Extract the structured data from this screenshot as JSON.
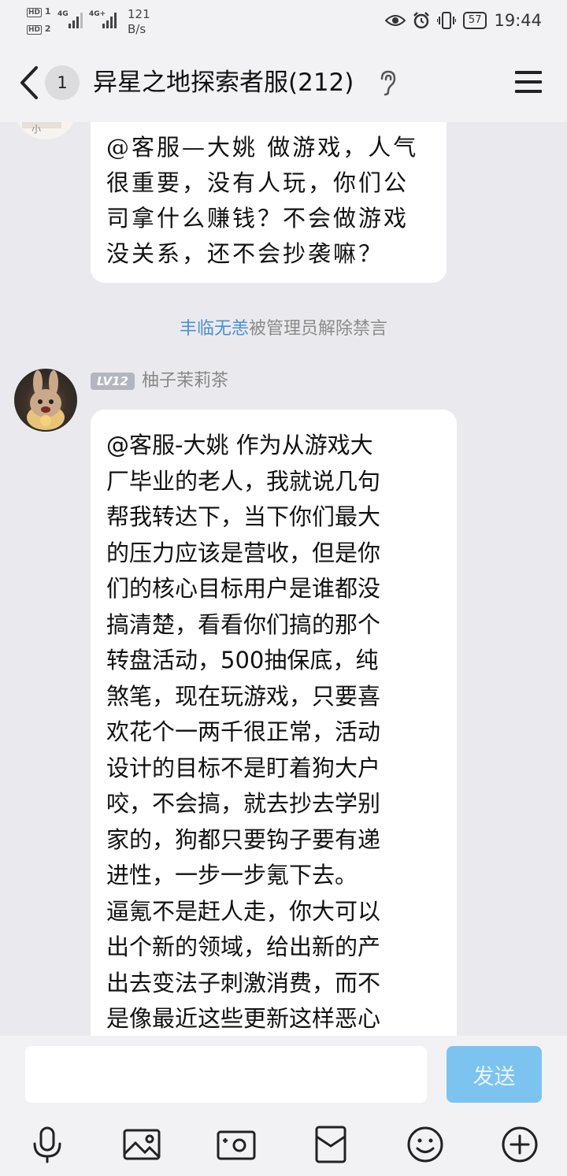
{
  "status_bar": {
    "sim1": "HD",
    "sim1_num": "1",
    "sim2": "HD",
    "sim2_num": "2",
    "net1": "4G",
    "net2": "4G+",
    "speed_value": "121",
    "speed_unit": "B/s",
    "battery": "57",
    "time": "19:44"
  },
  "header": {
    "unread_count": "1",
    "title": "异星之地探索者服(212)"
  },
  "messages": [
    {
      "text": "@客服—大姚 做游戏，人气\n很重要，没有人玩，你们公\n司拿什么赚钱？不会做游戏\n没关系，还不会抄袭嘛？"
    },
    {
      "notice_user": "丰临无恙",
      "notice_text": "被管理员解除禁言"
    },
    {
      "level": "LV12",
      "sender": "柚子茉莉茶",
      "text": "@客服-大姚 作为从游戏大\n厂毕业的老人，我就说几句\n帮我转达下，当下你们最大\n的压力应该是营收，但是你\n们的核心目标用户是谁都没\n搞清楚，看看你们搞的那个\n转盘活动，500抽保底，纯\n煞笔，现在玩游戏，只要喜\n欢花个一两千很正常，活动\n设计的目标不是盯着狗大户\n咬，不会搞，就去抄去学别\n家的，狗都只要钩子要有递\n进性，一步一步氪下去。\n逼氪不是赶人走，你大可以\n出个新的领域，给出新的产\n出去变法子刺激消费，而不\n是像最近这些更新这样恶心"
    }
  ],
  "input": {
    "value": "",
    "send_label": "发送"
  },
  "toolbar": {
    "icons": [
      "microphone-icon",
      "image-icon",
      "camera-icon",
      "red-packet-icon",
      "emoji-icon",
      "plus-icon"
    ]
  },
  "colors": {
    "background": "#eaeaee",
    "bar": "#f2f2f4",
    "send_button": "#7cc4ef",
    "link": "#4a8fd3"
  }
}
